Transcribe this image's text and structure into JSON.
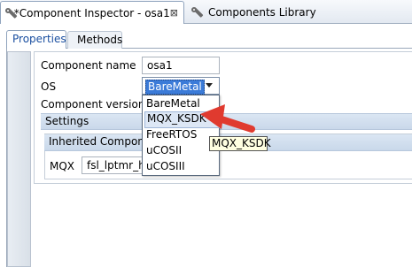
{
  "editor_tabs": [
    {
      "label": "*Component Inspector - osa1",
      "close": "⊠"
    },
    {
      "label": "Components Library"
    }
  ],
  "sub_tabs": [
    "Properties",
    "Methods"
  ],
  "fields": {
    "component_name_label": "Component name",
    "component_name_value": "osa1",
    "os_label": "OS",
    "os_value": "BareMetal",
    "component_version_label": "Component version"
  },
  "os_options": [
    "BareMetal",
    "MQX_KSDK",
    "FreeRTOS",
    "uCOSII",
    "uCOSIII"
  ],
  "highlighted_option": "MQX_KSDK",
  "tooltip": "MQX_KSDK",
  "settings_header": "Settings",
  "inherited_header": "Inherited Componen",
  "mqx_label": "MQX",
  "mqx_value": "fsl_lptmr_ha",
  "colors": {
    "selection": "#3b7bd8",
    "arrow": "#e03a2f",
    "header": "#d1deee"
  }
}
